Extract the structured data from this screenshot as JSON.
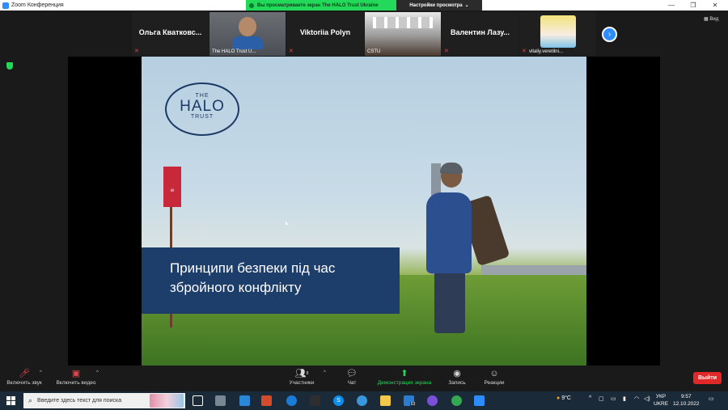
{
  "window": {
    "title": "Zoom Конференция",
    "minimize": "—",
    "maximize": "❐",
    "close": "✕"
  },
  "share_banner": {
    "text": "Вы просматриваете экран The HALO Trust Ukraine",
    "view_options": "Настройки просмотра"
  },
  "participants": [
    {
      "name": "Ольга Кватковс...",
      "label": "",
      "muted": true,
      "video": false
    },
    {
      "name": "",
      "label": "The HALO Trust U...",
      "muted": false,
      "video": true
    },
    {
      "name": "Viktoriia Polyn",
      "label": "",
      "muted": true,
      "video": false
    },
    {
      "name": "",
      "label": "CSTU",
      "muted": false,
      "video": true
    },
    {
      "name": "Валентин Лазу...",
      "label": "",
      "muted": true,
      "video": false
    },
    {
      "name": "",
      "label": "vitaliy.veretilni...",
      "muted": true,
      "video": true
    }
  ],
  "strip": {
    "next_label": "›",
    "view_label": "Вид"
  },
  "slide": {
    "logo_line1": "THE",
    "logo_line2": "HALO",
    "logo_line3": "TRUST",
    "title_line1": "Принципи безпеки під час",
    "title_line2": "збройного конфлікту"
  },
  "toolbar": {
    "unmute": "Включить звук",
    "start_video": "Включить видео",
    "participants": "Участники",
    "participants_count": "8",
    "chat": "Чат",
    "share": "Демонстрация экрана",
    "record": "Запись",
    "reactions": "Реакции",
    "leave": "Выйти"
  },
  "taskbar": {
    "search_placeholder": "Введите здесь текст для поиска",
    "weather": "9°C",
    "lang_line1": "УКР",
    "lang_line2": "UKRE",
    "time": "9:57",
    "date": "12.10.2022",
    "mail_badge": "63"
  },
  "colors": {
    "zoom_blue": "#2d8cff",
    "share_green": "#23d959",
    "leave_red": "#e02828",
    "slide_title_bg": "#1d3d6b"
  }
}
